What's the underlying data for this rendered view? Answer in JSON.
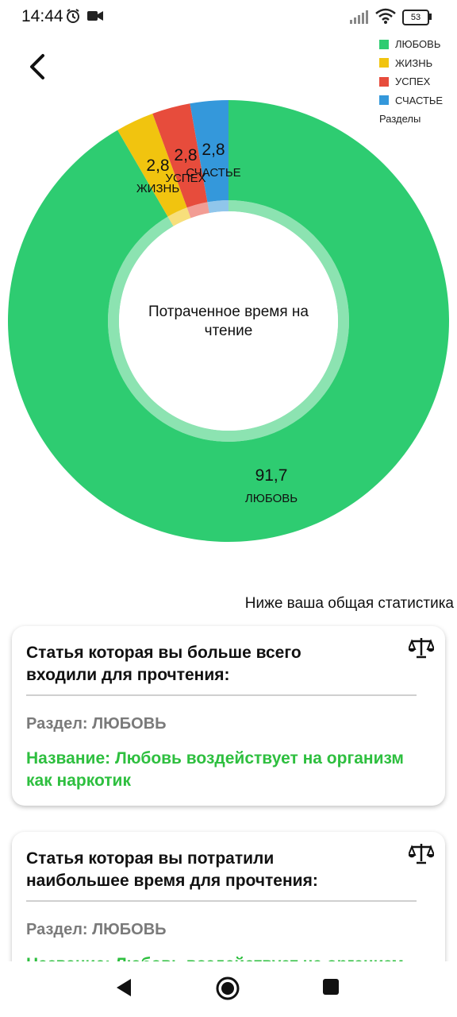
{
  "status": {
    "time": "14:44",
    "battery": "53"
  },
  "chart_data": {
    "type": "pie",
    "donut": true,
    "center_label": "Потраченное время на чтение",
    "slices": [
      {
        "label": "ЛЮБОВЬ",
        "value": 91.7,
        "value_text": "91,7",
        "color": "#2ecc71"
      },
      {
        "label": "ЖИЗНЬ",
        "value": 2.8,
        "value_text": "2,8",
        "color": "#f1c40f"
      },
      {
        "label": "УСПЕХ",
        "value": 2.8,
        "value_text": "2,8",
        "color": "#e74c3c"
      },
      {
        "label": "СЧАСТЬЕ",
        "value": 2.8,
        "value_text": "2,8",
        "color": "#3498db"
      }
    ],
    "legend": {
      "position": "top-right",
      "title": "Разделы",
      "entries": [
        "ЛЮБОВЬ",
        "ЖИЗНЬ",
        "УСПЕХ",
        "СЧАСТЬЕ"
      ]
    }
  },
  "summary_text": "Ниже ваша общая статистика",
  "cards": [
    {
      "title": "Статья которая вы больше всего входили для прочтения:",
      "section": "Раздел: ЛЮБОВЬ",
      "name": "Название: Любовь воздействует на организм как наркотик"
    },
    {
      "title": "Статья которая вы потратили наибольшее время для прочтения:",
      "section": "Раздел: ЛЮБОВЬ",
      "name": "Название: Любовь воздействует на организм как наркотик"
    }
  ],
  "icons": {
    "back": "arrow-back-icon",
    "card": "scale-icon",
    "nav_back": "triangle-back-icon",
    "nav_home": "circle-home-icon",
    "nav_recents": "square-recents-icon"
  }
}
